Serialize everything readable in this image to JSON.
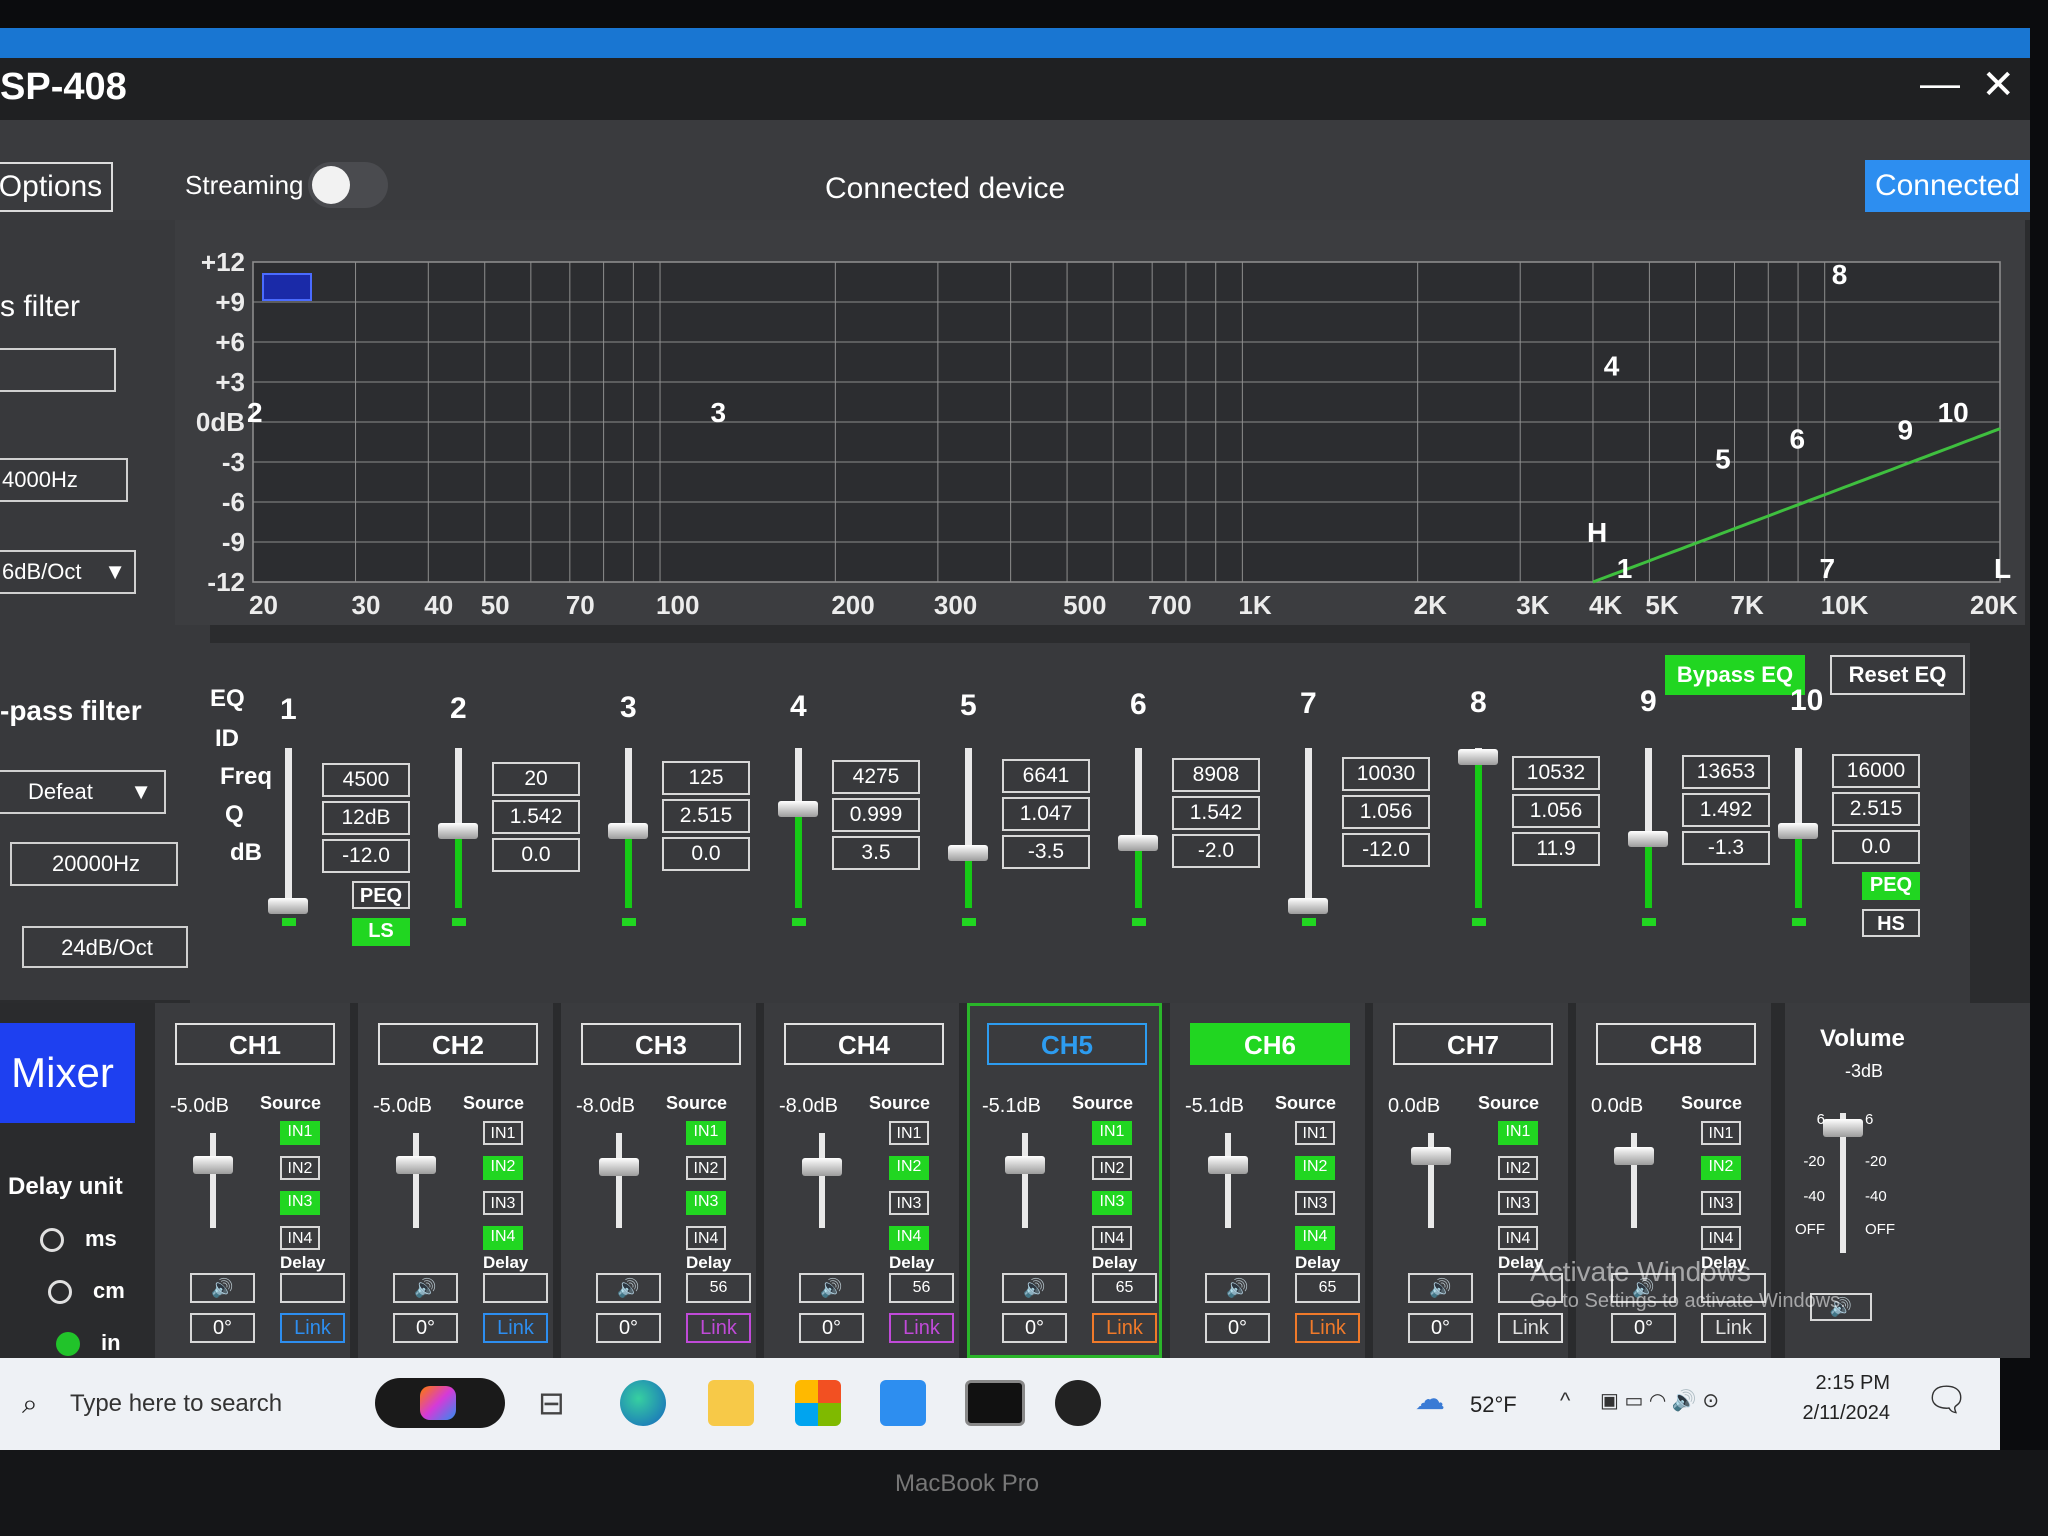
{
  "app": {
    "title": "SP-408",
    "window_controls": {
      "minimize": "—",
      "close": "✕"
    },
    "options_label": "Options",
    "streaming_label": "Streaming",
    "streaming_on": false,
    "status_center": "Connected device",
    "connected_label": "Connected"
  },
  "left_panel": {
    "high_pass_title": "s filter",
    "hp_freq": "4000Hz",
    "hp_slope": "6dB/Oct",
    "low_pass_title": "-pass filter",
    "lp_type": "Defeat",
    "lp_freq": "20000Hz",
    "lp_slope": "24dB/Oct",
    "link_icon": "link-chain-icon"
  },
  "graph": {
    "y_ticks": [
      "+12",
      "+9",
      "+6",
      "+3",
      "0dB",
      "-3",
      "-6",
      "-9",
      "-12"
    ],
    "x_ticks": [
      "20",
      "30",
      "40",
      "50",
      "70",
      "100",
      "200",
      "300",
      "500",
      "700",
      "1K",
      "2K",
      "3K",
      "4K",
      "5K",
      "7K",
      "10K",
      "20K"
    ],
    "band_markers": [
      {
        "label": "2",
        "freq": 20,
        "db": 0
      },
      {
        "label": "3",
        "freq": 125,
        "db": 0
      },
      {
        "label": "4",
        "freq": 4275,
        "db": 3.5
      },
      {
        "label": "5",
        "freq": 6641,
        "db": -3.5
      },
      {
        "label": "6",
        "freq": 8908,
        "db": -2.0
      },
      {
        "label": "7",
        "freq": 10030,
        "db": -12.0
      },
      {
        "label": "8",
        "freq": 10532,
        "db": 11.9
      },
      {
        "label": "9",
        "freq": 13653,
        "db": -1.3
      },
      {
        "label": "10",
        "freq": 16000,
        "db": 0.0
      },
      {
        "label": "1",
        "freq": 4500,
        "db": -12.0
      },
      {
        "label": "H",
        "freq": 4000,
        "db": -9
      },
      {
        "label": "L",
        "freq": 20000,
        "db": -12
      }
    ],
    "curve_color": "#3fbf3f"
  },
  "eq": {
    "labels": {
      "eq": "EQ",
      "id": "ID",
      "freq": "Freq",
      "q": "Q",
      "db": "dB"
    },
    "bypass_label": "Bypass EQ",
    "reset_label": "Reset EQ",
    "bands": [
      {
        "id": "1",
        "freq": "4500",
        "q": "12dB",
        "db": "-12.0",
        "type_top": "PEQ",
        "type_bottom": "LS",
        "active": "LS",
        "level": 0.0
      },
      {
        "id": "2",
        "freq": "20",
        "q": "1.542",
        "db": "0.0",
        "level": 0.5
      },
      {
        "id": "3",
        "freq": "125",
        "q": "2.515",
        "db": "0.0",
        "level": 0.5
      },
      {
        "id": "4",
        "freq": "4275",
        "q": "0.999",
        "db": "3.5",
        "level": 0.646
      },
      {
        "id": "5",
        "freq": "6641",
        "q": "1.047",
        "db": "-3.5",
        "level": 0.354
      },
      {
        "id": "6",
        "freq": "8908",
        "q": "1.542",
        "db": "-2.0",
        "level": 0.417
      },
      {
        "id": "7",
        "freq": "10030",
        "q": "1.056",
        "db": "-12.0",
        "level": 0.0
      },
      {
        "id": "8",
        "freq": "10532",
        "q": "1.056",
        "db": "11.9",
        "level": 0.996
      },
      {
        "id": "9",
        "freq": "13653",
        "q": "1.492",
        "db": "-1.3",
        "level": 0.446
      },
      {
        "id": "10",
        "freq": "16000",
        "q": "2.515",
        "db": "0.0",
        "type_top": "PEQ",
        "type_bottom": "HS",
        "active": "PEQ",
        "level": 0.5
      }
    ]
  },
  "mixer": {
    "mixer_label": "Mixer",
    "delay_unit_label": "Delay unit",
    "delay_units": [
      "ms",
      "cm",
      "in"
    ],
    "delay_unit_selected": "in",
    "source_label": "Source",
    "delay_label": "Delay",
    "link_label": "Link",
    "phase_label": "0°",
    "mute_glyph": "🔊",
    "channels": [
      {
        "name": "CH1",
        "gain": "-5.0dB",
        "inputs": [
          true,
          false,
          true,
          false
        ],
        "delay": "",
        "link_color": "#2d8ef0",
        "selected": false,
        "highlight": false,
        "level": 0.75
      },
      {
        "name": "CH2",
        "gain": "-5.0dB",
        "inputs": [
          false,
          true,
          false,
          true
        ],
        "delay": "",
        "link_color": "#2d8ef0",
        "selected": false,
        "highlight": false,
        "level": 0.75
      },
      {
        "name": "CH3",
        "gain": "-8.0dB",
        "inputs": [
          true,
          false,
          true,
          false
        ],
        "delay": "56",
        "link_color": "#c04ad8",
        "selected": false,
        "highlight": false,
        "level": 0.72
      },
      {
        "name": "CH4",
        "gain": "-8.0dB",
        "inputs": [
          false,
          true,
          false,
          true
        ],
        "delay": "56",
        "link_color": "#c04ad8",
        "selected": false,
        "highlight": false,
        "level": 0.72
      },
      {
        "name": "CH5",
        "gain": "-5.1dB",
        "inputs": [
          true,
          false,
          true,
          false
        ],
        "delay": "65",
        "link_color": "#f07a2a",
        "selected": true,
        "highlight": false,
        "level": 0.75
      },
      {
        "name": "CH6",
        "gain": "-5.1dB",
        "inputs": [
          false,
          true,
          false,
          true
        ],
        "delay": "65",
        "link_color": "#f07a2a",
        "selected": false,
        "highlight": true,
        "level": 0.75
      },
      {
        "name": "CH7",
        "gain": "0.0dB",
        "inputs": [
          true,
          false,
          false,
          false
        ],
        "delay": "",
        "link_color": "#e0e0e0",
        "selected": false,
        "highlight": false,
        "level": 0.85
      },
      {
        "name": "CH8",
        "gain": "0.0dB",
        "inputs": [
          false,
          true,
          false,
          false
        ],
        "delay": "",
        "link_color": "#e0e0e0",
        "selected": false,
        "highlight": false,
        "level": 0.85
      }
    ],
    "volume": {
      "label": "Volume",
      "value": "-3dB",
      "scale_left": [
        "6",
        "-20",
        "-40",
        "OFF"
      ],
      "scale_right": [
        "6",
        "-20",
        "-40",
        "OFF"
      ],
      "level": 0.95
    }
  },
  "watermark": {
    "line1": "Activate Windows",
    "line2": "Go to Settings to activate Windows."
  },
  "taskbar": {
    "search_placeholder": "Type here to search",
    "weather": "52°F",
    "time": "2:15 PM",
    "date": "2/11/2024"
  },
  "bezel_label": "MacBook Pro"
}
